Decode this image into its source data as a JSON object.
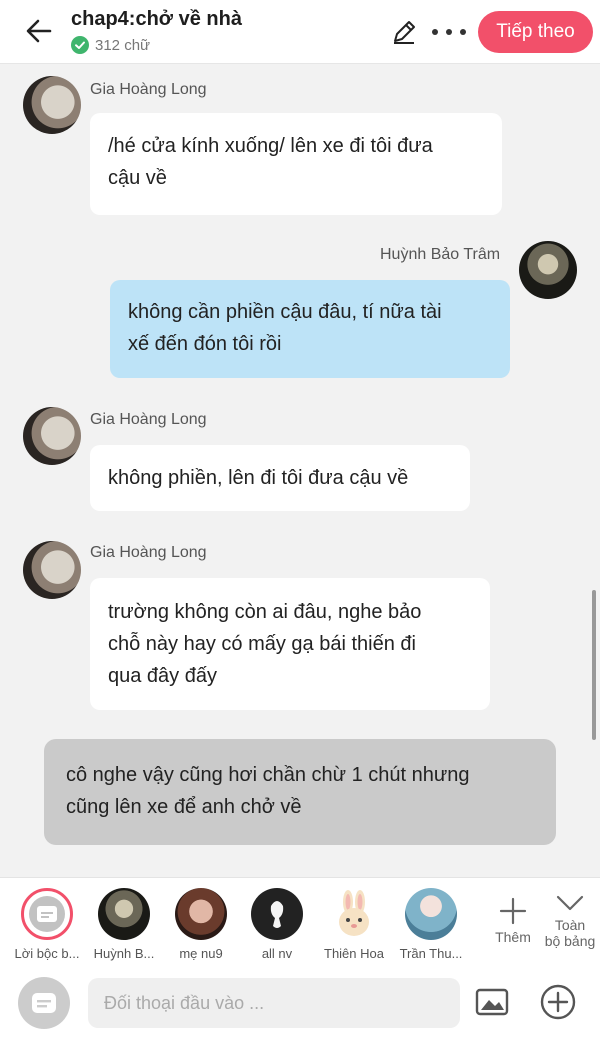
{
  "header": {
    "title": "chap4:chở về nhà",
    "word_count": "312 chữ",
    "next_label": "Tiếp theo",
    "accent_color": "#f2506a"
  },
  "messages": [
    {
      "speaker": "Gia Hoàng Long",
      "side": "left",
      "lines": [
        "/hé cửa kính xuống/ lên xe đi tôi đưa",
        "cậu về"
      ]
    },
    {
      "speaker": "Huỳnh Bảo Trâm",
      "side": "right",
      "lines": [
        "không cần phiền cậu đâu, tí nữa tài",
        "xế đến đón tôi rồi"
      ]
    },
    {
      "speaker": "Gia Hoàng Long",
      "side": "left",
      "lines": [
        "không phiền, lên đi tôi đưa cậu về"
      ]
    },
    {
      "speaker": "Gia Hoàng Long",
      "side": "left",
      "lines": [
        "trường không còn ai đâu, nghe bảo",
        "chỗ này hay có mấy gạ bái thiến đi",
        "qua đây đấy"
      ]
    },
    {
      "speaker": "",
      "side": "narration",
      "lines": [
        "cô nghe vậy cũng hơi chần chừ 1 chút nhưng",
        "cũng lên xe để anh chở về"
      ]
    }
  ],
  "characters": [
    {
      "name": "Lời bộc b...",
      "icon": "narration-icon",
      "selected": true
    },
    {
      "name": "Huỳnh B...",
      "icon": "avatar-huynh-bao-tram"
    },
    {
      "name": "mẹ nu9",
      "icon": "avatar-me-nu9"
    },
    {
      "name": "all nv",
      "icon": "avatar-silhouette"
    },
    {
      "name": "Thiên Hoa",
      "icon": "avatar-bunny"
    },
    {
      "name": "Trần Thu...",
      "icon": "avatar-tran-thu"
    }
  ],
  "tools": {
    "more_label": "Thêm",
    "all_label_1": "Toàn",
    "all_label_2": "bộ bảng"
  },
  "input": {
    "placeholder": "Đối thoại đầu vào ..."
  }
}
